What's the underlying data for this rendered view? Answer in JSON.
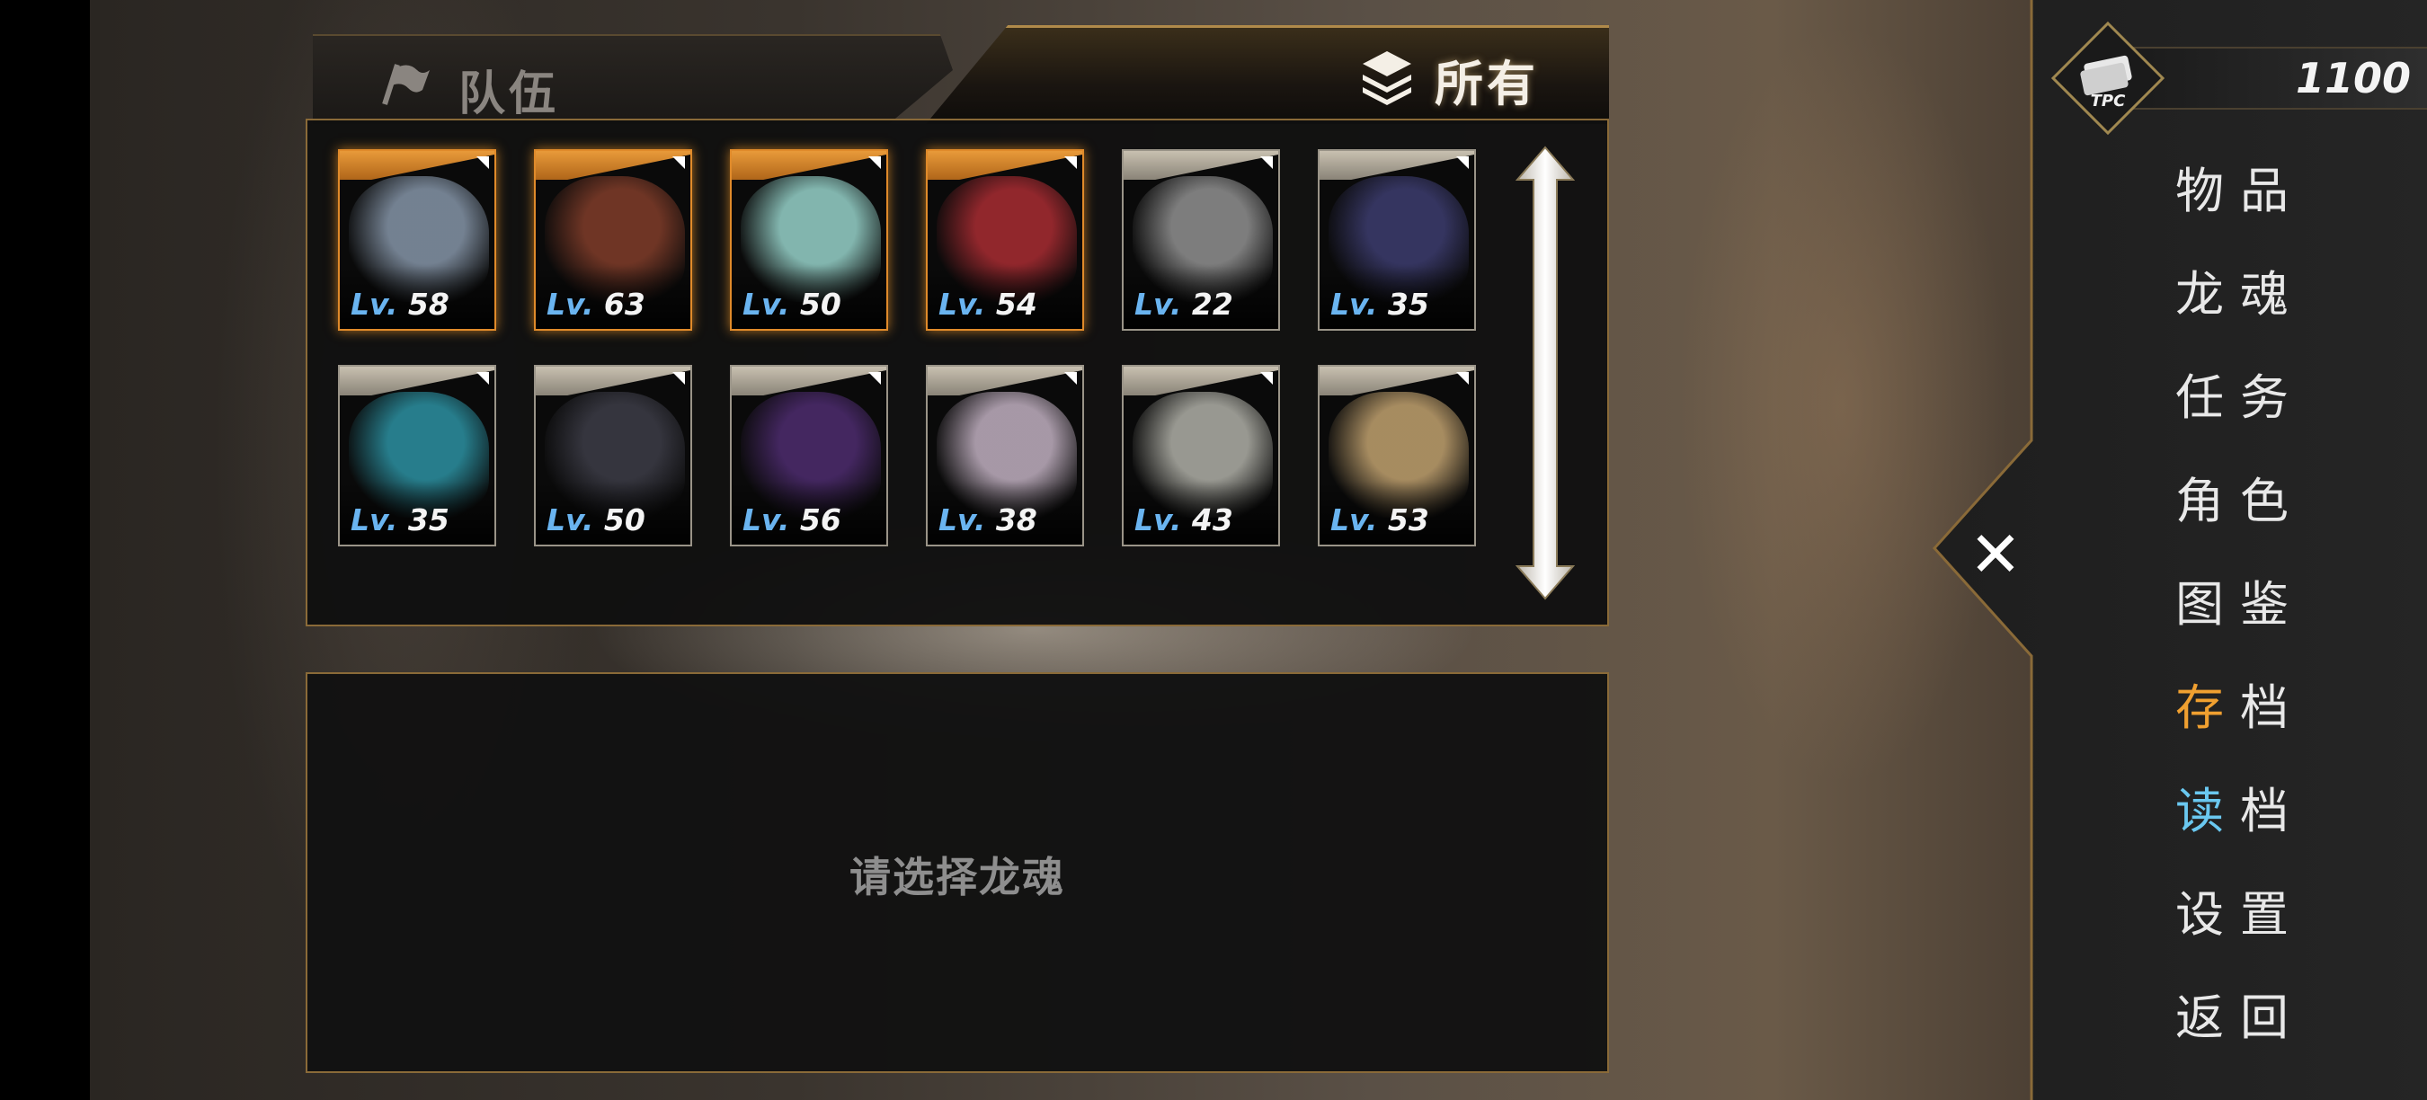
{
  "tabs": {
    "team_label": "队伍",
    "all_label": "所有"
  },
  "dragon_souls": [
    {
      "level_prefix": "Lv.",
      "level": "58",
      "in_team": true,
      "color": "#7f8ea0"
    },
    {
      "level_prefix": "Lv.",
      "level": "63",
      "in_team": true,
      "color": "#7a3a28"
    },
    {
      "level_prefix": "Lv.",
      "level": "50",
      "in_team": true,
      "color": "#8fc8c0"
    },
    {
      "level_prefix": "Lv.",
      "level": "54",
      "in_team": true,
      "color": "#a02a30"
    },
    {
      "level_prefix": "Lv.",
      "level": "22",
      "in_team": false,
      "color": "#8a8a8a"
    },
    {
      "level_prefix": "Lv.",
      "level": "35",
      "in_team": false,
      "color": "#3a3a6a"
    },
    {
      "level_prefix": "Lv.",
      "level": "35",
      "in_team": false,
      "color": "#2a8a9a"
    },
    {
      "level_prefix": "Lv.",
      "level": "50",
      "in_team": false,
      "color": "#3a3a44"
    },
    {
      "level_prefix": "Lv.",
      "level": "56",
      "in_team": false,
      "color": "#4a2a6a"
    },
    {
      "level_prefix": "Lv.",
      "level": "38",
      "in_team": false,
      "color": "#b8a8b8"
    },
    {
      "level_prefix": "Lv.",
      "level": "43",
      "in_team": false,
      "color": "#a8a8a0"
    },
    {
      "level_prefix": "Lv.",
      "level": "53",
      "in_team": false,
      "color": "#b89a6a"
    }
  ],
  "detail": {
    "prompt": "请选择龙魂"
  },
  "currency": {
    "icon_label": "TPC",
    "value": "1100"
  },
  "menu": [
    {
      "first": "物",
      "rest": "品",
      "accent": ""
    },
    {
      "first": "龙",
      "rest": "魂",
      "accent": ""
    },
    {
      "first": "任",
      "rest": "务",
      "accent": ""
    },
    {
      "first": "角",
      "rest": "色",
      "accent": ""
    },
    {
      "first": "图",
      "rest": "鉴",
      "accent": ""
    },
    {
      "first": "存",
      "rest": "档",
      "accent": "#f0a030"
    },
    {
      "first": "读",
      "rest": "档",
      "accent": "#6ac8f0"
    },
    {
      "first": "设",
      "rest": "置",
      "accent": ""
    },
    {
      "first": "返",
      "rest": "回",
      "accent": ""
    }
  ],
  "close_glyph": "✕",
  "colors": {
    "gold_border": "#8a6a38",
    "team_border": "#e08a2a",
    "level_prefix": "#6ab4f0"
  }
}
